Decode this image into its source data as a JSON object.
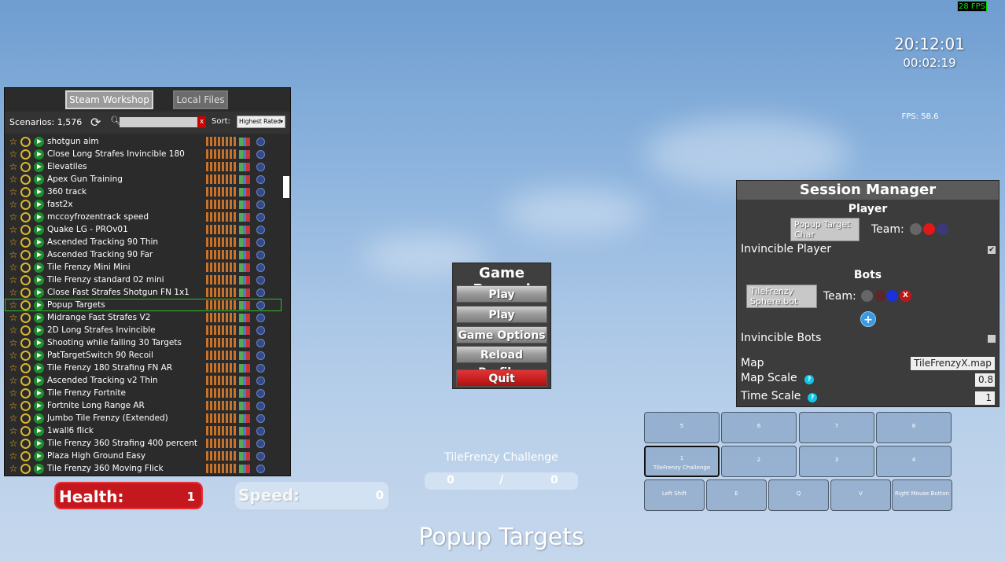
{
  "hud": {
    "fps_top": "28 FPS",
    "clock": "20:12:01",
    "timer": "00:02:19",
    "fps_mid": "FPS: 58.6",
    "health_label": "Health:",
    "health_value": "1",
    "speed_label": "Speed:",
    "speed_value": "0",
    "scenario_name": "Popup Targets"
  },
  "browser": {
    "tabs": [
      "Steam Workshop",
      "Local Files"
    ],
    "count": "Scenarios: 1,576",
    "search_clear": "x",
    "sort_label": "Sort:",
    "sort_value": "Highest Rated",
    "scenarios": [
      "shotgun aim",
      "Close Long Strafes Invincible 180",
      "Elevatiles",
      "Apex Gun Training",
      "360 track",
      "fast2x",
      "mccoyfrozentrack speed",
      "Quake LG - PROv01",
      "Ascended Tracking 90 Thin",
      "Ascended Tracking 90 Far",
      "Tile Frenzy Mini Mini",
      "Tile Frenzy standard 02 mini",
      "Close Fast Strafes Shotgun FN 1x1",
      "Popup Targets",
      "Midrange Fast Strafes V2",
      "2D Long Strafes Invincible",
      "Shooting while falling 30 Targets",
      "PatTargetSwitch 90 Recoil",
      "Tile Frenzy 180 Strafing FN AR",
      "Ascended Tracking v2 Thin",
      "Tile Frenzy Fortnite",
      "Fortnite Long Range AR",
      "Jumbo Tile Frenzy (Extended)",
      "1wall6 flick",
      "Tile Frenzy 360 Strafing 400 percent",
      "Plaza High Ground Easy",
      "Tile Frenzy 360 Moving Flick"
    ],
    "selected_index": 13
  },
  "pause": {
    "title": "Game Paused",
    "play": "Play",
    "play_challenge": "Play Challenge",
    "game_options": "Game Options",
    "reload_profiles": "Reload Profiles",
    "quit": "Quit"
  },
  "challenge": {
    "title": "TileFrenzy Challenge",
    "left": "0",
    "separator": "/",
    "right": "0"
  },
  "hotkeys": {
    "k5": "5",
    "k6": "6",
    "k7": "7",
    "k8": "8",
    "k1": "1",
    "k1_sub": "TileFrenzy Challenge",
    "k2": "2",
    "k3": "3",
    "k4": "4",
    "shift": "Left Shift",
    "e": "E",
    "q": "Q",
    "v": "V",
    "rmb": "Right Mouse Button"
  },
  "session": {
    "title": "Session Manager",
    "player_heading": "Player",
    "player_char": "Popup Target Char",
    "team_label": "Team:",
    "invincible_player": "Invincible Player",
    "invincible_player_check": "✔",
    "bots_heading": "Bots",
    "bot_char": "TileFrenzy Sphere.bot",
    "bot_team_label": "Team:",
    "bot_remove": "X",
    "add_bot": "+",
    "invincible_bots": "Invincible Bots",
    "map_label": "Map",
    "map_value": "TileFrenzyX.map",
    "map_scale_label": "Map Scale",
    "map_scale_value": "0.8",
    "time_scale_label": "Time Scale",
    "time_scale_value": "1",
    "help": "?"
  },
  "colors": {
    "health_red": "#c5171e",
    "quit_red": "#b01010",
    "select_green": "#2fbf2f",
    "team_red": "#e01818",
    "team_blue": "#1a30d8"
  }
}
